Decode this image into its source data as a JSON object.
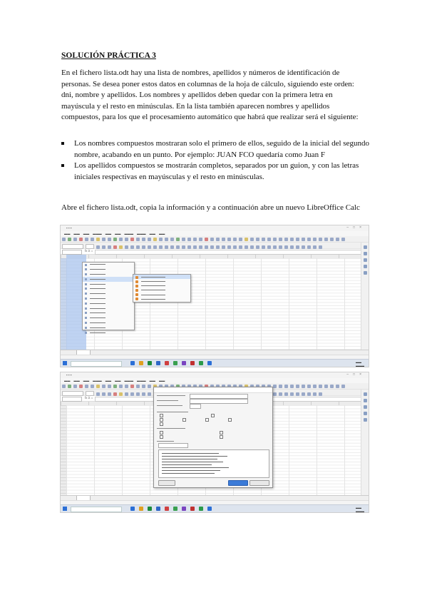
{
  "document": {
    "title": "SOLUCIÓN PRÁCTICA 3",
    "intro": "En el fichero lista.odt hay una lista de nombres, apellidos y números de identificación de personas. Se desea poner estos datos en columnas de la hoja de cálculo, siguiendo este orden: dni, nombre y apellidos. Los nombres y apellidos deben quedar con la primera letra en mayúscula y el resto en minúsculas. En la lista también aparecen nombres y apellidos compuestos, para los que el procesamiento automático que habrá que realizar será el siguiente:",
    "bullets": [
      "Los nombres compuestos mostraran solo el primero de ellos, seguido de la inicial del segundo nombre, acabando en un punto. Por ejemplo: JUAN FCO quedaría como Juan F",
      "Los apellidos compuestos se mostrarán completos, separados por un guion, y con las letras iniciales respectivas en mayúsculas y el resto en minúsculas."
    ],
    "closing": "Abre el fichero lista.odt, copia la información y a continuación abre un nuevo LibreOffice Calc"
  },
  "screenshots": [
    {
      "kind": "calc-context-menu",
      "selected_column": "A"
    },
    {
      "kind": "calc-text-import-dialog"
    }
  ],
  "colors": {
    "selection": "#a9c4ee",
    "taskbar": "#dde4ee",
    "menu_highlight": "#cfe0f7"
  }
}
